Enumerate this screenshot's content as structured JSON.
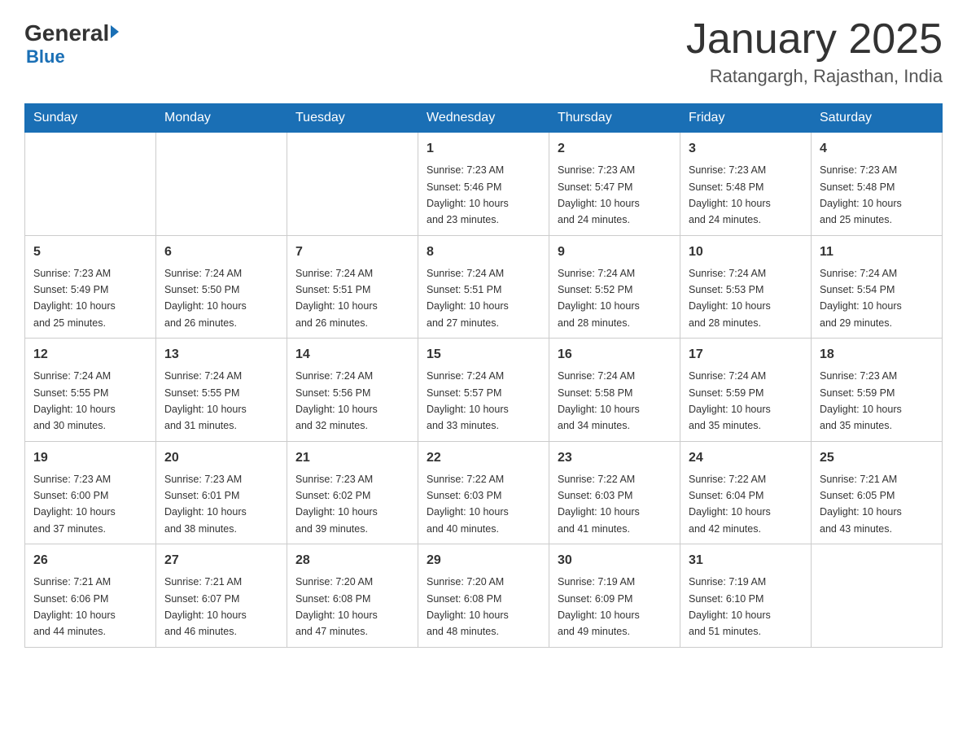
{
  "header": {
    "logo_general": "General",
    "logo_blue": "Blue",
    "month_title": "January 2025",
    "location": "Ratangargh, Rajasthan, India"
  },
  "days_of_week": [
    "Sunday",
    "Monday",
    "Tuesday",
    "Wednesday",
    "Thursday",
    "Friday",
    "Saturday"
  ],
  "weeks": [
    [
      null,
      null,
      null,
      {
        "day": "1",
        "sunrise": "7:23 AM",
        "sunset": "5:46 PM",
        "daylight": "10 hours and 23 minutes."
      },
      {
        "day": "2",
        "sunrise": "7:23 AM",
        "sunset": "5:47 PM",
        "daylight": "10 hours and 24 minutes."
      },
      {
        "day": "3",
        "sunrise": "7:23 AM",
        "sunset": "5:48 PM",
        "daylight": "10 hours and 24 minutes."
      },
      {
        "day": "4",
        "sunrise": "7:23 AM",
        "sunset": "5:48 PM",
        "daylight": "10 hours and 25 minutes."
      }
    ],
    [
      {
        "day": "5",
        "sunrise": "7:23 AM",
        "sunset": "5:49 PM",
        "daylight": "10 hours and 25 minutes."
      },
      {
        "day": "6",
        "sunrise": "7:24 AM",
        "sunset": "5:50 PM",
        "daylight": "10 hours and 26 minutes."
      },
      {
        "day": "7",
        "sunrise": "7:24 AM",
        "sunset": "5:51 PM",
        "daylight": "10 hours and 26 minutes."
      },
      {
        "day": "8",
        "sunrise": "7:24 AM",
        "sunset": "5:51 PM",
        "daylight": "10 hours and 27 minutes."
      },
      {
        "day": "9",
        "sunrise": "7:24 AM",
        "sunset": "5:52 PM",
        "daylight": "10 hours and 28 minutes."
      },
      {
        "day": "10",
        "sunrise": "7:24 AM",
        "sunset": "5:53 PM",
        "daylight": "10 hours and 28 minutes."
      },
      {
        "day": "11",
        "sunrise": "7:24 AM",
        "sunset": "5:54 PM",
        "daylight": "10 hours and 29 minutes."
      }
    ],
    [
      {
        "day": "12",
        "sunrise": "7:24 AM",
        "sunset": "5:55 PM",
        "daylight": "10 hours and 30 minutes."
      },
      {
        "day": "13",
        "sunrise": "7:24 AM",
        "sunset": "5:55 PM",
        "daylight": "10 hours and 31 minutes."
      },
      {
        "day": "14",
        "sunrise": "7:24 AM",
        "sunset": "5:56 PM",
        "daylight": "10 hours and 32 minutes."
      },
      {
        "day": "15",
        "sunrise": "7:24 AM",
        "sunset": "5:57 PM",
        "daylight": "10 hours and 33 minutes."
      },
      {
        "day": "16",
        "sunrise": "7:24 AM",
        "sunset": "5:58 PM",
        "daylight": "10 hours and 34 minutes."
      },
      {
        "day": "17",
        "sunrise": "7:24 AM",
        "sunset": "5:59 PM",
        "daylight": "10 hours and 35 minutes."
      },
      {
        "day": "18",
        "sunrise": "7:23 AM",
        "sunset": "5:59 PM",
        "daylight": "10 hours and 35 minutes."
      }
    ],
    [
      {
        "day": "19",
        "sunrise": "7:23 AM",
        "sunset": "6:00 PM",
        "daylight": "10 hours and 37 minutes."
      },
      {
        "day": "20",
        "sunrise": "7:23 AM",
        "sunset": "6:01 PM",
        "daylight": "10 hours and 38 minutes."
      },
      {
        "day": "21",
        "sunrise": "7:23 AM",
        "sunset": "6:02 PM",
        "daylight": "10 hours and 39 minutes."
      },
      {
        "day": "22",
        "sunrise": "7:22 AM",
        "sunset": "6:03 PM",
        "daylight": "10 hours and 40 minutes."
      },
      {
        "day": "23",
        "sunrise": "7:22 AM",
        "sunset": "6:03 PM",
        "daylight": "10 hours and 41 minutes."
      },
      {
        "day": "24",
        "sunrise": "7:22 AM",
        "sunset": "6:04 PM",
        "daylight": "10 hours and 42 minutes."
      },
      {
        "day": "25",
        "sunrise": "7:21 AM",
        "sunset": "6:05 PM",
        "daylight": "10 hours and 43 minutes."
      }
    ],
    [
      {
        "day": "26",
        "sunrise": "7:21 AM",
        "sunset": "6:06 PM",
        "daylight": "10 hours and 44 minutes."
      },
      {
        "day": "27",
        "sunrise": "7:21 AM",
        "sunset": "6:07 PM",
        "daylight": "10 hours and 46 minutes."
      },
      {
        "day": "28",
        "sunrise": "7:20 AM",
        "sunset": "6:08 PM",
        "daylight": "10 hours and 47 minutes."
      },
      {
        "day": "29",
        "sunrise": "7:20 AM",
        "sunset": "6:08 PM",
        "daylight": "10 hours and 48 minutes."
      },
      {
        "day": "30",
        "sunrise": "7:19 AM",
        "sunset": "6:09 PM",
        "daylight": "10 hours and 49 minutes."
      },
      {
        "day": "31",
        "sunrise": "7:19 AM",
        "sunset": "6:10 PM",
        "daylight": "10 hours and 51 minutes."
      },
      null
    ]
  ],
  "labels": {
    "sunrise_label": "Sunrise:",
    "sunset_label": "Sunset:",
    "daylight_label": "Daylight:"
  }
}
